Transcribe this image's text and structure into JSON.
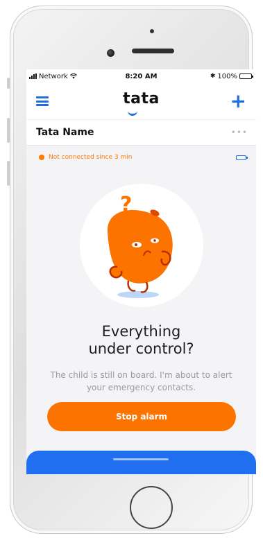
{
  "status_bar": {
    "carrier": "Network",
    "time": "8:20 AM",
    "battery_percent": "100%",
    "bluetooth_icon": "bluetooth-icon",
    "wifi_icon": "wifi-icon"
  },
  "nav": {
    "logo": "tata",
    "menu_icon": "hamburger-menu-icon",
    "add_icon": "plus-icon",
    "add_label": "+"
  },
  "device": {
    "name": "Tata Name",
    "more_label": "•••"
  },
  "connection": {
    "status_text": "Not connected since 3 min",
    "status_color": "#ff7a00",
    "battery_icon": "battery-icon"
  },
  "alert": {
    "illustration": "confused-mascot-illustration",
    "question_mark": "?",
    "heading": "Everything\nunder control?",
    "body": "The child is still on board. I'm about to alert\nyour emergency contacts.",
    "button_label": "Stop alarm"
  },
  "colors": {
    "accent_blue": "#1f6ff0",
    "alarm_orange": "#fd7300"
  }
}
